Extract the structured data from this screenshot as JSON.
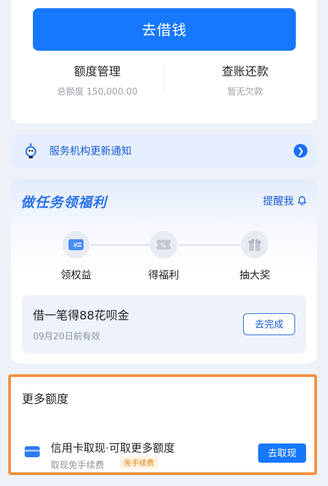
{
  "top": {
    "borrow_label": "去借钱",
    "quota_title": "额度管理",
    "quota_sub": "总额度 150,000.00",
    "bill_title": "查账还款",
    "bill_sub": "暂无欠款"
  },
  "notice": {
    "text": "服务机构更新通知",
    "accent": "#1a5bd6"
  },
  "tasks": {
    "title": "做任务领福利",
    "remind_label": "提醒我",
    "steps": [
      {
        "label": "领权益",
        "icon": "yen-card-icon"
      },
      {
        "label": "得福利",
        "icon": "coupon-icon"
      },
      {
        "label": "抽大奖",
        "icon": "gift-icon"
      }
    ],
    "offer_title": "借一笔得88花呗金",
    "offer_sub": "09月20日前有效",
    "offer_button": "去完成"
  },
  "more": {
    "title": "更多额度",
    "cc_title": "信用卡取现·可取更多额度",
    "cc_sub": "取现免手续费",
    "cc_badge": "免手续费",
    "cc_button": "去取现",
    "highlight": "#f5923e"
  },
  "colors": {
    "primary": "#1677ff",
    "background": "#eef2f8"
  }
}
